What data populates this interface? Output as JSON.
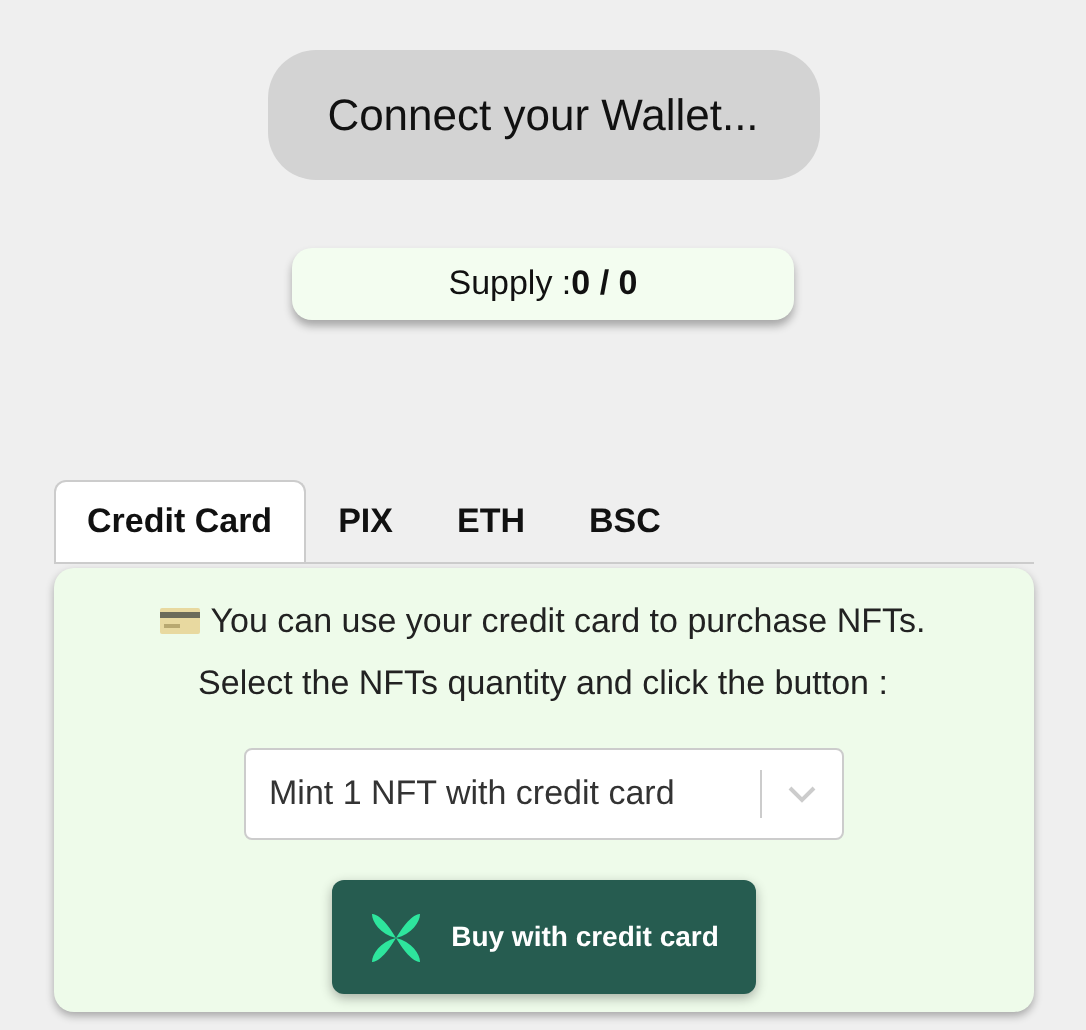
{
  "connect_button": {
    "label": "Connect your Wallet..."
  },
  "supply": {
    "label": "Supply : ",
    "value": "0 / 0"
  },
  "tabs": [
    {
      "label": "Credit Card",
      "selected": true
    },
    {
      "label": "PIX",
      "selected": false
    },
    {
      "label": "ETH",
      "selected": false
    },
    {
      "label": "BSC",
      "selected": false
    }
  ],
  "panel": {
    "lines": [
      "You can use your credit card to purchase NFTs.",
      "Select the NFTs quantity and click the button :"
    ],
    "select": {
      "value": "Mint 1 NFT with credit card"
    },
    "buy_button": {
      "label": "Buy with credit card"
    }
  }
}
